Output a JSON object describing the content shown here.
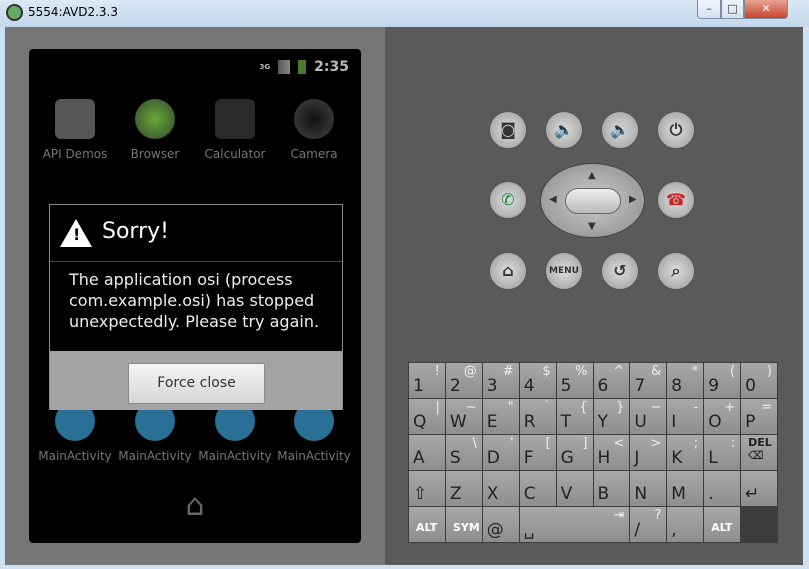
{
  "window": {
    "title": "5554:AVD2.3.3",
    "minimize": "–",
    "maximize": "□",
    "close": "✕"
  },
  "status_bar": {
    "network": "3G",
    "time": "2:35"
  },
  "apps": [
    {
      "label": "API Demos"
    },
    {
      "label": "Browser"
    },
    {
      "label": "Calculator"
    },
    {
      "label": "Camera"
    },
    {
      "label": "MainActivity"
    },
    {
      "label": "MainActivity"
    },
    {
      "label": "MainActivity"
    },
    {
      "label": "MainActivity"
    }
  ],
  "dialog": {
    "title": "Sorry!",
    "message": "The application osi (process com.example.osi) has stopped unexpectedly. Please try again.",
    "button": "Force close"
  },
  "controls": {
    "menu": "MENU"
  },
  "keyboard": {
    "rows": [
      [
        [
          "1",
          "!"
        ],
        [
          "2",
          "@"
        ],
        [
          "3",
          "#"
        ],
        [
          "4",
          "$"
        ],
        [
          "5",
          "%"
        ],
        [
          "6",
          "^"
        ],
        [
          "7",
          "&"
        ],
        [
          "8",
          "*"
        ],
        [
          "9",
          "("
        ],
        [
          "0",
          ")"
        ]
      ],
      [
        [
          "Q",
          "|"
        ],
        [
          "W",
          "~"
        ],
        [
          "E",
          "\""
        ],
        [
          "R",
          "`"
        ],
        [
          "T",
          "{"
        ],
        [
          "Y",
          "}"
        ],
        [
          "U",
          "−"
        ],
        [
          "I",
          "-"
        ],
        [
          "O",
          "+"
        ],
        [
          "P",
          "="
        ]
      ],
      [
        [
          "A",
          ""
        ],
        [
          "S",
          "\\"
        ],
        [
          "D",
          "'"
        ],
        [
          "F",
          "["
        ],
        [
          "G",
          "]"
        ],
        [
          "H",
          "<"
        ],
        [
          "J",
          ">"
        ],
        [
          "K",
          ";"
        ],
        [
          "L",
          ":"
        ],
        [
          "DEL ⌫",
          ""
        ]
      ],
      [
        [
          "⇧",
          ""
        ],
        [
          "Z",
          ""
        ],
        [
          "X",
          ""
        ],
        [
          "C",
          ""
        ],
        [
          "V",
          ""
        ],
        [
          "B",
          ""
        ],
        [
          "N",
          ""
        ],
        [
          "M",
          ""
        ],
        [
          ".",
          ""
        ],
        [
          "↵",
          ""
        ]
      ],
      [
        [
          "ALT",
          ""
        ],
        [
          "SYM",
          ""
        ],
        [
          "@",
          ""
        ],
        [
          "␣",
          "⇥"
        ],
        [
          "/",
          "?"
        ],
        [
          ",",
          ""
        ],
        [
          "ALT",
          ""
        ]
      ]
    ]
  }
}
